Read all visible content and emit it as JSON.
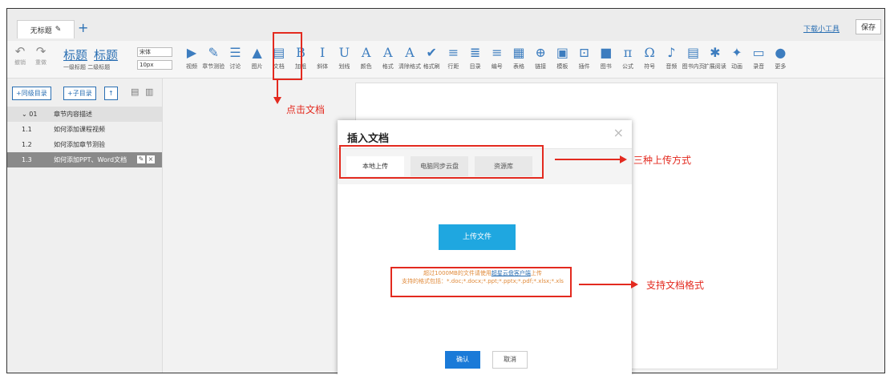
{
  "tabbar": {
    "doc_tab": "无标题",
    "edit_icon": "pencil-icon",
    "add": "+",
    "download": "下载小工具",
    "save": "保存"
  },
  "toolbar": {
    "undo": "撤销",
    "redo": "重做",
    "heading_big_1": "标题",
    "heading_big_2": "标题",
    "heading_small": "一级标题 二级标题",
    "font": "宋体",
    "size": "10px",
    "tools": [
      {
        "icon": "▶",
        "label": "视频"
      },
      {
        "icon": "✎",
        "label": "章节测验"
      },
      {
        "icon": "☰",
        "label": "讨论"
      },
      {
        "icon": "▲",
        "label": "图片"
      },
      {
        "icon": "▤",
        "label": "文档"
      },
      {
        "icon": "B",
        "label": "加粗"
      },
      {
        "icon": "I",
        "label": "斜体"
      },
      {
        "icon": "U",
        "label": "划线"
      },
      {
        "icon": "A",
        "label": "颜色"
      },
      {
        "icon": "A",
        "label": "格式"
      },
      {
        "icon": "A",
        "label": "清除格式"
      },
      {
        "icon": "✔",
        "label": "格式刷"
      },
      {
        "icon": "≡",
        "label": "行距"
      },
      {
        "icon": "≣",
        "label": "目录"
      },
      {
        "icon": "≡",
        "label": "编号"
      },
      {
        "icon": "▦",
        "label": "表格"
      },
      {
        "icon": "⊕",
        "label": "链接"
      },
      {
        "icon": "▣",
        "label": "模板"
      },
      {
        "icon": "⊡",
        "label": "插件"
      },
      {
        "icon": "■",
        "label": "图书"
      },
      {
        "icon": "π",
        "label": "公式"
      },
      {
        "icon": "Ω",
        "label": "符号"
      },
      {
        "icon": "♪",
        "label": "音频"
      },
      {
        "icon": "▤",
        "label": "图书内页"
      },
      {
        "icon": "✱",
        "label": "扩展阅读"
      },
      {
        "icon": "✦",
        "label": "动画"
      },
      {
        "icon": "▭",
        "label": "录音"
      },
      {
        "icon": "●",
        "label": "更多"
      }
    ]
  },
  "sidebar": {
    "add_chapter": "+同级目录",
    "add_sub": "+子目录",
    "up": "↑",
    "items": [
      {
        "num": "⌄ 01",
        "text": "章节内容描述"
      },
      {
        "num": "1.1",
        "text": "如何添加课程视频"
      },
      {
        "num": "1.2",
        "text": "如何添加章节测验"
      },
      {
        "num": "1.3",
        "text": "如何添加PPT、Word文档"
      }
    ]
  },
  "dialog": {
    "title": "插入文档",
    "close": "×",
    "tabs": [
      "本地上传",
      "电脑同步云盘",
      "资源库"
    ],
    "upload": "上传文件",
    "notice_1a": "超过1000MB的文件请使用",
    "notice_link": "超星云盘客户端",
    "notice_1b": "上传",
    "notice_2": "支持的格式包括：*.doc;*.docx;*.ppt;*.pptx;*.pdf;*.xlsx;*.xls",
    "confirm": "确认",
    "cancel": "取消"
  },
  "annotations": {
    "click_doc": "点击文档",
    "three_ways": "三种上传方式",
    "formats": "支持文档格式"
  },
  "colors": {
    "accent": "#2a6fb3",
    "upload": "#1fa7e0",
    "confirm": "#1a7ad8",
    "annotation": "#e32a1f"
  }
}
